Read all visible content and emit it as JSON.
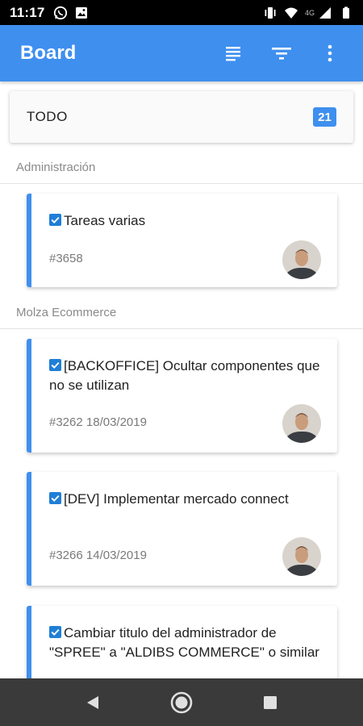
{
  "status_bar": {
    "time": "11:17",
    "network_label": "4G",
    "left_icons": [
      "whatsapp-icon",
      "image-icon"
    ],
    "right_icons": [
      "vibrate-icon",
      "wifi-icon",
      "signal-icon",
      "battery-icon"
    ]
  },
  "app_bar": {
    "title": "Board",
    "actions": [
      "list-view-icon",
      "filter-icon",
      "more-vert-icon"
    ]
  },
  "column": {
    "title": "TODO",
    "count": "21"
  },
  "groups": [
    {
      "label": "Administración",
      "cards": [
        {
          "title": "Tareas varias",
          "meta": "#3658"
        }
      ]
    },
    {
      "label": "Molza Ecommerce",
      "cards": [
        {
          "title": "[BACKOFFICE] Ocultar componentes que no se utilizan",
          "meta": "#3262 18/03/2019"
        },
        {
          "title": "[DEV] Implementar mercado connect",
          "meta": "#3266 14/03/2019"
        },
        {
          "title": "Cambiar titulo del administrador de \"SPREE\" a \"ALDIBS COMMERCE\" o similar",
          "meta": ""
        }
      ]
    }
  ],
  "colors": {
    "primary": "#3f8fef",
    "card_accent": "#3f8fef",
    "status_bar": "#000000",
    "nav_bar": "#3a3a3a"
  },
  "nav": [
    "back-icon",
    "home-icon",
    "recents-icon"
  ]
}
